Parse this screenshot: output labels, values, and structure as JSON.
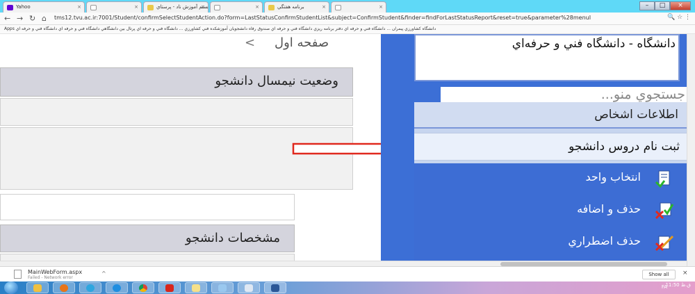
{
  "browser": {
    "tabs": [
      {
        "label": "Yahoo",
        "color": "#6001d2"
      },
      {
        "label": "",
        "color": "#ffffff"
      },
      {
        "label": "سیستم آموزش ناد - پرستاي",
        "color": "#e9c94a"
      },
      {
        "label": "",
        "color": "#ffffff"
      },
      {
        "label": "برنامه هفتگي",
        "color": "#e9c94a"
      },
      {
        "label": "",
        "color": "#ffffff"
      }
    ],
    "url": "tms12.tvu.ac.ir:7001/Student/confirmSelectStudentAction.do?form=LastStatusConfirmStudentList&subject=ConfirmStudent&finder=findForLastStatusReport&reset=true&parameter%28menuI",
    "bookmarks": "Apps   دانشگاه کشاورزي پيمران ...   دانشگاه فني و حرفه اي   دفتر برنامه ريزي   دانشگاه فني و حرفه اي   صندوق رفاه دانشجويان   آموزشکده فني کشاورزي ...   دانشگاه فني و حرفه اي   پرتال بين دانشگاهي   دانشگاه فني و حرفه اي   دانشگاه فني و حرفه اي"
  },
  "page": {
    "header_title": "صفحه اول",
    "header_arrow": "<",
    "section_semester": "وضعيت نيمسال دانشجو",
    "section_profile": "مشخصات دانشجو"
  },
  "sidebar": {
    "university": "دانشگاه - دانشگاه فني و حرفه‌اي",
    "search_placeholder": "جستجوي منو...",
    "menu_head": "اطلاعات اشخاص",
    "menu_selected": "ثبت نام دروس دانشجو",
    "sub_items": [
      {
        "label": "انتخاب واحد",
        "icon": "form-icon"
      },
      {
        "label": "حذف و اضافه",
        "icon": "add-remove-icon"
      },
      {
        "label": "حذف اضطراري",
        "icon": "emergency-drop-icon"
      }
    ]
  },
  "downloads": {
    "file_name": "MainWebForm.aspx",
    "file_status": "Failed - Network error",
    "show_all": "Show all"
  },
  "taskbar": {
    "tray_lang": "FA",
    "clock_time": "11:50 ق.ظ"
  },
  "colors": {
    "frame_green": "#3fd13a",
    "sidebar_blue": "#3d6dd4",
    "arrow_red": "#e0291e"
  }
}
